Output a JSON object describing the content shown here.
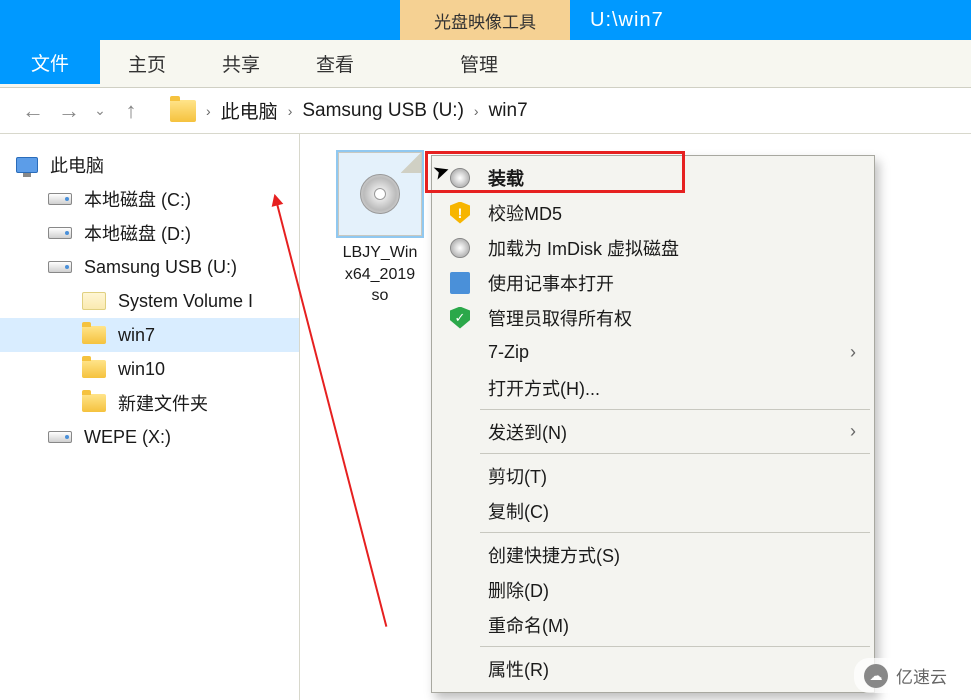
{
  "titlebar": {
    "tool_label": "光盘映像工具",
    "path_text": "U:\\win7"
  },
  "ribbon": {
    "file": "文件",
    "tabs": [
      "主页",
      "共享",
      "查看"
    ],
    "manage": "管理"
  },
  "breadcrumb": {
    "segments": [
      "此电脑",
      "Samsung USB (U:)",
      "win7"
    ]
  },
  "tree": {
    "root": "此电脑",
    "drives": [
      {
        "label": "本地磁盘 (C:)"
      },
      {
        "label": "本地磁盘 (D:)"
      },
      {
        "label": "Samsung USB (U:)",
        "expanded": true,
        "children": [
          {
            "label": "System Volume I",
            "icon": "folder-pale"
          },
          {
            "label": "win7",
            "selected": true,
            "icon": "folder"
          },
          {
            "label": "win10",
            "icon": "folder"
          },
          {
            "label": "新建文件夹",
            "icon": "folder"
          }
        ]
      },
      {
        "label": "WEPE (X:)"
      }
    ]
  },
  "files": [
    {
      "name": "LBJY_Win\nx64_2019\nso",
      "type": "iso",
      "selected": true
    }
  ],
  "context_menu": {
    "groups": [
      [
        {
          "icon": "disc",
          "label": "装载",
          "highlighted": true
        },
        {
          "icon": "shield-warn",
          "label": "校验MD5"
        },
        {
          "icon": "disc",
          "label": "加载为 ImDisk 虚拟磁盘"
        },
        {
          "icon": "notepad",
          "label": "使用记事本打开"
        },
        {
          "icon": "shield-ok",
          "label": "管理员取得所有权"
        },
        {
          "icon": "",
          "label": "7-Zip",
          "submenu": true
        },
        {
          "icon": "",
          "label": "打开方式(H)..."
        }
      ],
      [
        {
          "icon": "",
          "label": "发送到(N)",
          "submenu": true
        }
      ],
      [
        {
          "icon": "",
          "label": "剪切(T)"
        },
        {
          "icon": "",
          "label": "复制(C)"
        }
      ],
      [
        {
          "icon": "",
          "label": "创建快捷方式(S)"
        },
        {
          "icon": "",
          "label": "删除(D)"
        },
        {
          "icon": "",
          "label": "重命名(M)"
        }
      ],
      [
        {
          "icon": "",
          "label": "属性(R)"
        }
      ]
    ]
  },
  "watermark": "亿速云"
}
